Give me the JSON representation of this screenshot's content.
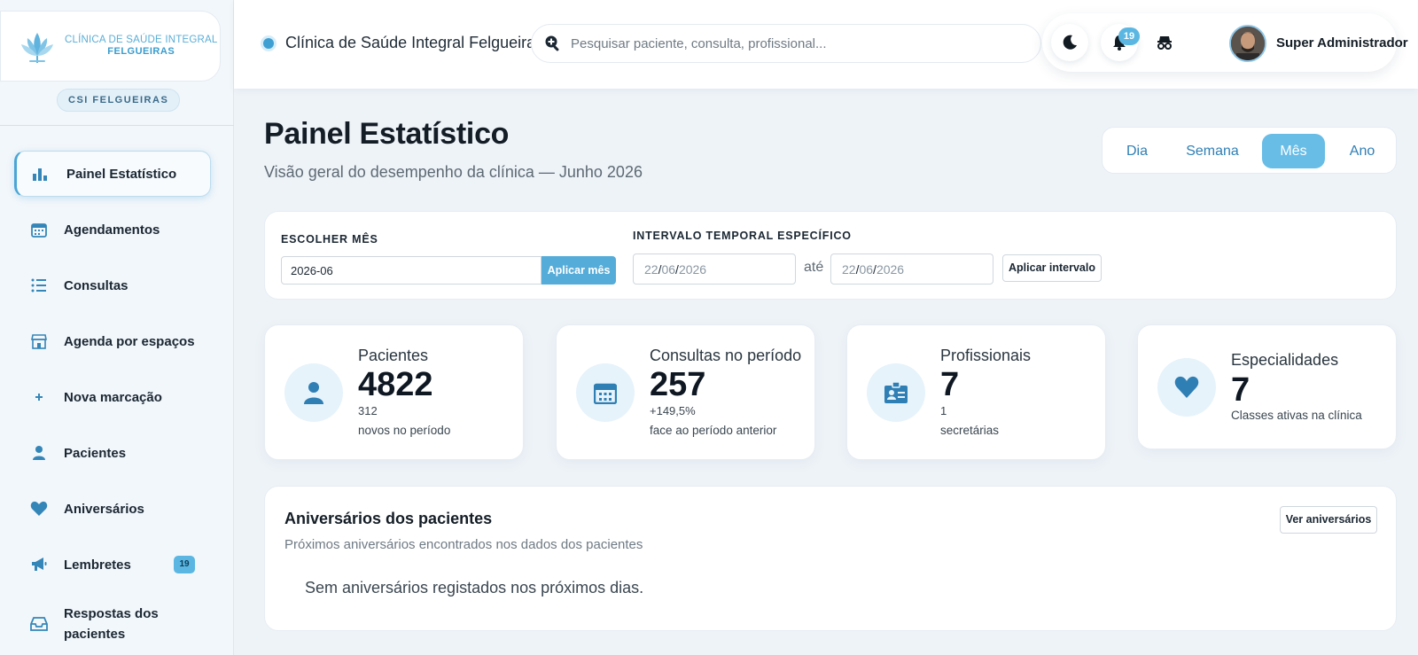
{
  "brand": {
    "logo_line1": "CLÍNICA DE SAÚDE INTEGRAL",
    "logo_line2": "FELGUEIRAS",
    "clinic_chip": "CSI FELGUEIRAS",
    "accent_color": "#4aa5d6"
  },
  "sidebar": {
    "items": [
      {
        "label": "Painel Estatístico",
        "icon": "bar-chart-icon",
        "active": true
      },
      {
        "label": "Agendamentos",
        "icon": "calendar-icon"
      },
      {
        "label": "Consultas",
        "icon": "list-icon"
      },
      {
        "label": "Agenda por espaços",
        "icon": "store-icon"
      },
      {
        "label": "Nova marcação",
        "icon": "plus-icon"
      },
      {
        "label": "Pacientes",
        "icon": "user-icon"
      },
      {
        "label": "Aniversários",
        "icon": "heart-icon"
      },
      {
        "label": "Lembretes",
        "icon": "megaphone-icon",
        "badge": "19"
      },
      {
        "label": "Respostas dos pacientes",
        "icon": "inbox-icon"
      }
    ]
  },
  "header": {
    "title": "Clínica de Saúde Integral Felgueiras",
    "search_placeholder": "Pesquisar paciente, consulta, profissional...",
    "notifications_count": "19",
    "user_name": "Super Administrador"
  },
  "main": {
    "title": "Painel Estatístico",
    "subtitle": "Visão geral do desempenho da clínica — Junho 2026",
    "period_tabs": [
      "Dia",
      "Semana",
      "Mês",
      "Ano"
    ],
    "active_period": "Mês"
  },
  "filters": {
    "month_label": "ESCOLHER MÊS",
    "month_value": "2026-06",
    "apply_month": "Aplicar mês",
    "range_label": "INTERVALO TEMPORAL ESPECÍFICO",
    "date_day": "22",
    "date_month": "06",
    "date_year": "2026",
    "range_sep": "até",
    "apply_range": "Aplicar intervalo"
  },
  "stats": [
    {
      "label": "Pacientes",
      "value": "4822",
      "sub1": "312",
      "sub2": "novos no período",
      "icon": "user-icon"
    },
    {
      "label": "Consultas no período",
      "value": "257",
      "sub1": "+149,5%",
      "sub2": "face ao período anterior",
      "icon": "calendar-icon"
    },
    {
      "label": "Profissionais",
      "value": "7",
      "sub1": "1",
      "sub2": "secretárias",
      "icon": "id-badge-icon"
    },
    {
      "label": "Especialidades",
      "value": "7",
      "sub2": "Classes ativas na clínica",
      "icon": "heart-icon"
    }
  ],
  "birthdays": {
    "title": "Aniversários dos pacientes",
    "subtitle": "Próximos aniversários encontrados nos dados dos pacientes",
    "button": "Ver aniversários",
    "empty": "Sem aniversários registados nos próximos dias."
  }
}
